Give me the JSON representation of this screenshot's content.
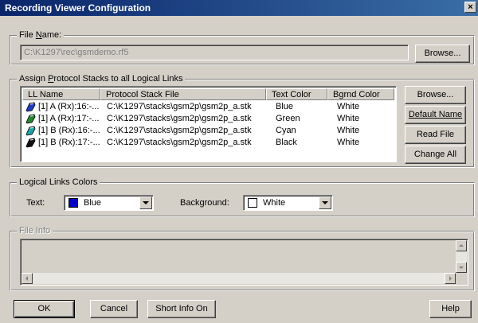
{
  "window": {
    "title": "Recording Viewer Configuration",
    "close_label": "×"
  },
  "file_name": {
    "label_pre": "File ",
    "label_key": "N",
    "label_post": "ame:",
    "value": "C:\\K1297\\rec\\gsmdemo.rf5",
    "browse_label": "Browse..."
  },
  "assign": {
    "label_pre": "Assign ",
    "label_key": "P",
    "label_post": "rotocol Stacks to all Logical Links",
    "columns": [
      "LL Name",
      "Protocol Stack File",
      "Text Color",
      "Bgrnd Color"
    ],
    "rows": [
      {
        "icon": "blue-link-icon",
        "icon_color": "#1e3cc8",
        "name": "[1] A (Rx):16:-...",
        "file": "C:\\K1297\\stacks\\gsm2p\\gsm2p_a.stk",
        "text_color": "Blue",
        "bg_color": "White"
      },
      {
        "icon": "green-link-icon",
        "icon_color": "#1f8a2a",
        "name": "[1] A (Rx):17:-...",
        "file": "C:\\K1297\\stacks\\gsm2p\\gsm2p_a.stk",
        "text_color": "Green",
        "bg_color": "White"
      },
      {
        "icon": "cyan-link-icon",
        "icon_color": "#1aa6a6",
        "name": "[1] B (Rx):16:-...",
        "file": "C:\\K1297\\stacks\\gsm2p\\gsm2p_a.stk",
        "text_color": "Cyan",
        "bg_color": "White"
      },
      {
        "icon": "black-link-icon",
        "icon_color": "#111111",
        "name": "[1] B (Rx):17:-...",
        "file": "C:\\K1297\\stacks\\gsm2p\\gsm2p_a.stk",
        "text_color": "Black",
        "bg_color": "White"
      }
    ],
    "buttons": {
      "browse": "Browse...",
      "default_name": "Default Name",
      "read_file": "Read File",
      "change_all": "Change All"
    }
  },
  "colors": {
    "label": "Logical Links Colors",
    "text_label": "Text:",
    "text_value": "Blue",
    "text_swatch": "#0000c8",
    "background_label": "Background:",
    "background_value": "White",
    "background_swatch": "#ffffff"
  },
  "file_info": {
    "label": "File Info"
  },
  "footer": {
    "ok": "OK",
    "cancel": "Cancel",
    "short_info": "Short Info On",
    "help": "Help"
  }
}
